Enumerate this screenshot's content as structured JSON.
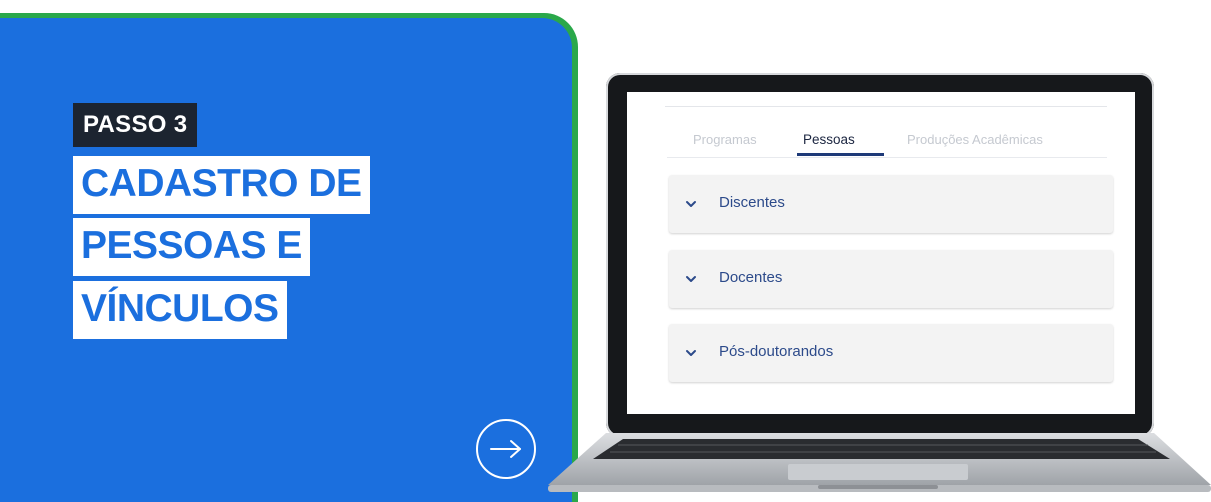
{
  "slide": {
    "step_label": "PASSO 3",
    "title_lines": [
      "CADASTRO DE",
      "PESSOAS E",
      "VÍNCULOS"
    ],
    "next_icon": "arrow-right-icon",
    "colors": {
      "panel": "#1b6fde",
      "panel_border": "#2aa84a",
      "step_bg": "#1c2430",
      "title_text": "#1b6fde"
    }
  },
  "screen": {
    "tabs": [
      {
        "label": "Programas",
        "active": false
      },
      {
        "label": "Pessoas",
        "active": true
      },
      {
        "label": "Produções Acadêmicas",
        "active": false
      }
    ],
    "accordion": [
      {
        "label": "Discentes",
        "icon": "chevron-down-icon"
      },
      {
        "label": "Docentes",
        "icon": "chevron-down-icon"
      },
      {
        "label": "Pós-doutorandos",
        "icon": "chevron-down-icon"
      }
    ]
  }
}
